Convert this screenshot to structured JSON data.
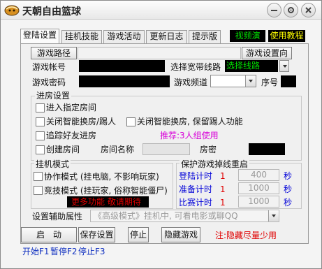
{
  "window": {
    "title": "天朝自由篮球"
  },
  "links": {
    "video": "视频演示",
    "tutorial": "使用教程"
  },
  "tabs": [
    "登陆设置",
    "挂机技能",
    "游戏活动",
    "更新日志",
    "提示版"
  ],
  "login": {
    "game_path_button": "游戏路径",
    "game_settings_button": "游戏设置向导",
    "account_label": "游戏帐号",
    "line_label": "选择宽带线路",
    "line_value": "选择线路",
    "password_label": "游戏密码",
    "channel_label": "游戏频道",
    "seq_label": "序号"
  },
  "room": {
    "title": "进房设置",
    "enter_room": "进入指定房间",
    "close_smart_kick": "关闭智能换房/踢人",
    "close_smart_keep": "关闭智能换房, 保留踢人功能",
    "follow_friend": "追踪好友进房",
    "recommend": "推荐:3人组使用",
    "create_room": "创建房间",
    "room_name_label": "房间名称",
    "room_pwd_label": "房密"
  },
  "mode": {
    "title": "挂机模式",
    "coop": "协作模式 (挂电脑, 不影响玩家)",
    "compete": "竞技模式 (挂玩家, 俗称智能僵尸)",
    "more_banner": "更多功能 敬请期待"
  },
  "reconnect": {
    "title": "保护游戏掉线重启",
    "login_timer": "登陆计时",
    "login_n": "1",
    "login_val": "400",
    "prep_timer": "准备计时",
    "prep_n": "1",
    "prep_val": "1000",
    "match_timer": "比赛计时",
    "match_n": "1",
    "match_val": "1000",
    "unit": "秒"
  },
  "assist": {
    "label": "设置辅助属性",
    "placeholder": "《高级模式》挂机中, 可看电影或聊QQ"
  },
  "buttons": {
    "start": "启　动",
    "save": "保存设置",
    "stop": "停止",
    "hide": "隐藏游戏",
    "note": "注:隐藏尽量少用"
  },
  "hotkeys": {
    "start": "开始F1",
    "pause": "暂停F2",
    "stop": "停止F3"
  },
  "colors": {
    "accent_red": "#e00000",
    "accent_blue": "#0000d8",
    "link_green": "#00d800",
    "link_yellow": "#ffff00",
    "hotkey_blue": "#1030c0"
  }
}
